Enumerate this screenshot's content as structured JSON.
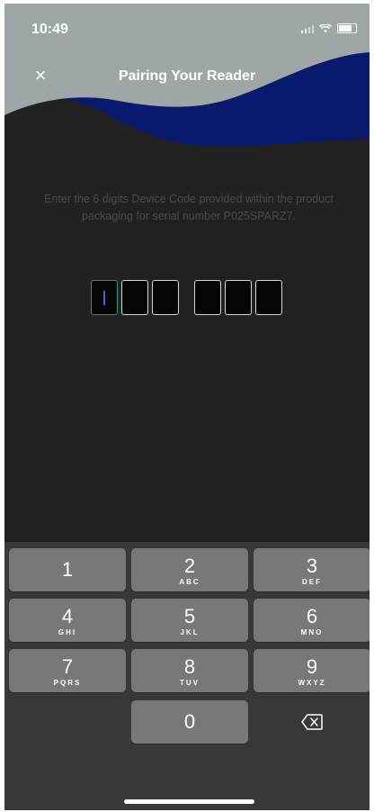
{
  "status_bar": {
    "time": "10:49"
  },
  "nav": {
    "title": "Pairing Your Reader",
    "close_icon": "×"
  },
  "instructions": "Enter the 6 digits Device Code provided within the product packaging for serial number P025SPARZ7.",
  "code_inputs": [
    "",
    "",
    "",
    "",
    "",
    ""
  ],
  "keypad": {
    "keys": [
      {
        "num": "1",
        "letters": ""
      },
      {
        "num": "2",
        "letters": "ABC"
      },
      {
        "num": "3",
        "letters": "DEF"
      },
      {
        "num": "4",
        "letters": "GHI"
      },
      {
        "num": "5",
        "letters": "JKL"
      },
      {
        "num": "6",
        "letters": "MNO"
      },
      {
        "num": "7",
        "letters": "PQRS"
      },
      {
        "num": "8",
        "letters": "TUV"
      },
      {
        "num": "9",
        "letters": "WXYZ"
      },
      {
        "num": "0",
        "letters": ""
      }
    ]
  },
  "colors": {
    "header_grey": "#9ea6a8",
    "header_navy": "#0a1a6e",
    "background": "#212121",
    "keypad_bg": "#383838",
    "key": "#787878"
  }
}
